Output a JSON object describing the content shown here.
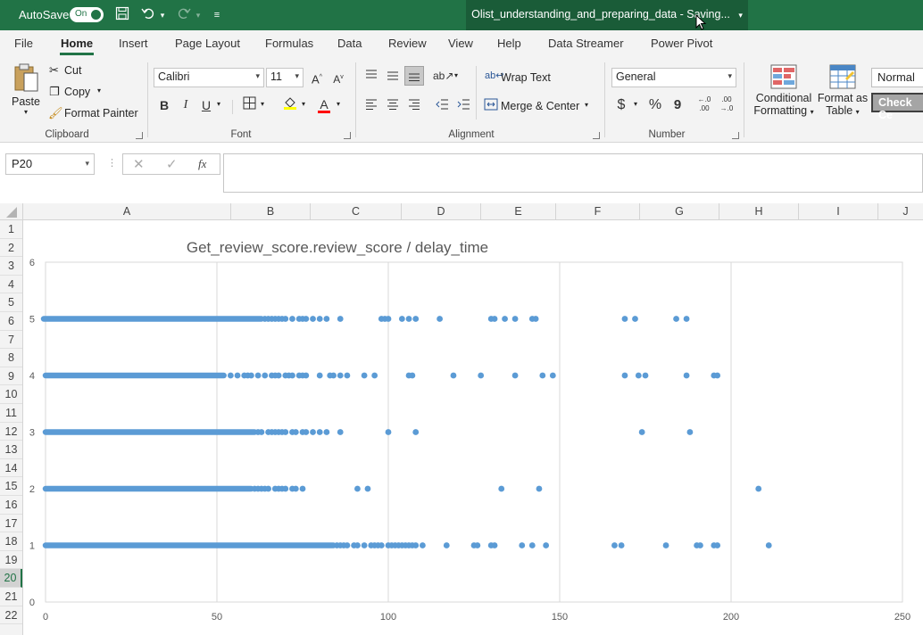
{
  "titlebar": {
    "autosave_label": "AutoSave",
    "toggle_label": "On",
    "doc_title": "Olist_understanding_and_preparing_data  -  Saving...",
    "bg_color": "#217346"
  },
  "tabs": [
    "File",
    "Home",
    "Insert",
    "Page Layout",
    "Formulas",
    "Data",
    "Review",
    "View",
    "Help",
    "Data Streamer",
    "Power Pivot"
  ],
  "active_tab": "Home",
  "ribbon": {
    "clipboard": {
      "paste": "Paste",
      "cut": "Cut",
      "copy": "Copy",
      "format_painter": "Format Painter",
      "group": "Clipboard"
    },
    "font": {
      "font_name": "Calibri",
      "font_size": "11",
      "bold": "B",
      "italic": "I",
      "underline": "U",
      "group": "Font"
    },
    "alignment": {
      "wrap_text": "Wrap Text",
      "merge_center": "Merge & Center",
      "group": "Alignment"
    },
    "number": {
      "format": "General",
      "currency": "$",
      "percent": "%",
      "comma": "9",
      "group": "Number"
    },
    "styles": {
      "conditional_1": "Conditional",
      "conditional_2": "Formatting",
      "format_table_1": "Format as",
      "format_table_2": "Table",
      "normal": "Normal",
      "check_cell": "Check Ce"
    }
  },
  "formula_bar": {
    "name_box": "P20",
    "fx": "fx",
    "formula": ""
  },
  "columns": [
    "A",
    "B",
    "C",
    "D",
    "E",
    "F",
    "G",
    "H",
    "I",
    "J"
  ],
  "rows": [
    "1",
    "2",
    "3",
    "4",
    "5",
    "6",
    "7",
    "8",
    "9",
    "10",
    "11",
    "12",
    "13",
    "14",
    "15",
    "16",
    "17",
    "18",
    "19",
    "20",
    "21",
    "22"
  ],
  "selected_row": "20",
  "chart_data": {
    "type": "scatter",
    "title": "Get_review_score.review_score / delay_time",
    "xlim": [
      0,
      250
    ],
    "ylim": [
      0,
      6
    ],
    "x_ticks": [
      "0",
      "50",
      "100",
      "150",
      "200",
      "250"
    ],
    "y_ticks": [
      "0",
      "1",
      "2",
      "3",
      "4",
      "5",
      "6"
    ],
    "grid": "vertical",
    "marker_color": "#5b9bd5",
    "series": [
      {
        "y": 5,
        "dense_to": 63,
        "x": [
          64,
          65,
          66,
          67,
          68,
          69,
          70,
          72,
          74,
          75,
          76,
          78,
          80,
          82,
          86,
          98,
          99,
          100,
          104,
          106,
          108,
          115,
          130,
          131,
          134,
          137,
          142,
          143,
          169,
          172,
          184,
          187
        ]
      },
      {
        "y": 4,
        "dense_to": 52,
        "x": [
          54,
          56,
          58,
          59,
          60,
          62,
          64,
          66,
          67,
          68,
          70,
          71,
          72,
          74,
          75,
          76,
          80,
          83,
          84,
          86,
          88,
          93,
          96,
          106,
          107,
          119,
          127,
          137,
          145,
          148,
          169,
          173,
          175,
          187,
          195,
          196
        ]
      },
      {
        "y": 3,
        "dense_to": 61,
        "x": [
          62,
          63,
          65,
          66,
          67,
          68,
          69,
          70,
          72,
          73,
          75,
          76,
          78,
          80,
          82,
          86,
          100,
          108,
          174,
          188
        ]
      },
      {
        "y": 2,
        "dense_to": 60,
        "x": [
          61,
          62,
          63,
          64,
          65,
          67,
          68,
          69,
          70,
          72,
          73,
          75,
          91,
          94,
          133,
          144,
          208
        ]
      },
      {
        "y": 1,
        "dense_to": 84,
        "x": [
          85,
          86,
          87,
          88,
          90,
          91,
          93,
          95,
          96,
          97,
          98,
          100,
          101,
          102,
          103,
          104,
          105,
          106,
          107,
          108,
          110,
          117,
          125,
          126,
          130,
          131,
          139,
          142,
          146,
          166,
          168,
          181,
          190,
          191,
          195,
          196,
          211
        ]
      }
    ]
  }
}
